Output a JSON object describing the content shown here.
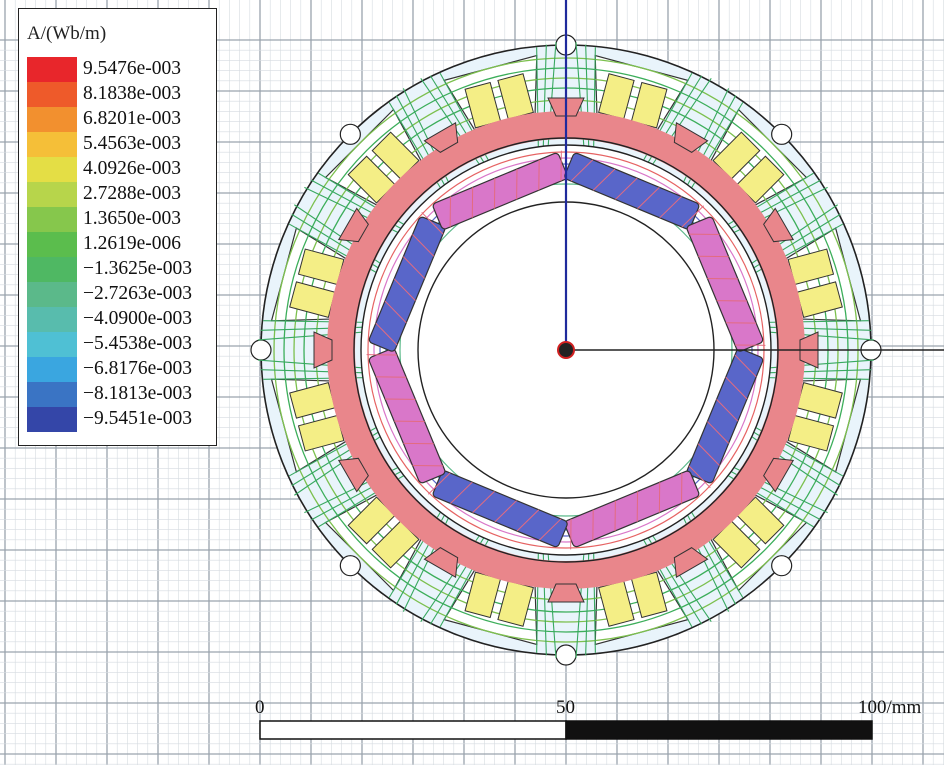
{
  "legend": {
    "title": "A/(Wb/m)",
    "entries": [
      {
        "value": "9.5476e-003",
        "color": "#e8262b"
      },
      {
        "value": "8.1838e-003",
        "color": "#ee5a2a"
      },
      {
        "value": "6.8201e-003",
        "color": "#f2902f"
      },
      {
        "value": "5.4563e-003",
        "color": "#f5bf38"
      },
      {
        "value": "4.0926e-003",
        "color": "#e4de45"
      },
      {
        "value": "2.7288e-003",
        "color": "#b7d54b"
      },
      {
        "value": "1.3650e-003",
        "color": "#86c74c"
      },
      {
        "value": "1.2619e-006",
        "color": "#5bbd4d"
      },
      {
        "value": "−1.3625e-003",
        "color": "#4fb863"
      },
      {
        "value": "−2.7263e-003",
        "color": "#5bb98a"
      },
      {
        "value": "−4.0900e-003",
        "color": "#58bcad"
      },
      {
        "value": "−5.4538e-003",
        "color": "#4fc0d4"
      },
      {
        "value": "−6.8176e-003",
        "color": "#3aa6e0"
      },
      {
        "value": "−8.1813e-003",
        "color": "#3a74c4"
      },
      {
        "value": "−9.5451e-003",
        "color": "#3446a8"
      }
    ]
  },
  "scale_bar": {
    "labels": [
      "0",
      "50",
      "100/mm"
    ]
  },
  "diagram": {
    "stator_slots": 12,
    "rotor_poles": 8,
    "colors": {
      "grid": "#9aa3ad",
      "stator_fill": "#e9f4fb",
      "coil": "#f4ee86",
      "rotor_ring": "#e9868b",
      "magnet_blue": "#5966c9",
      "magnet_pink": "#d977c9",
      "axis": "#1f2a9c"
    }
  }
}
